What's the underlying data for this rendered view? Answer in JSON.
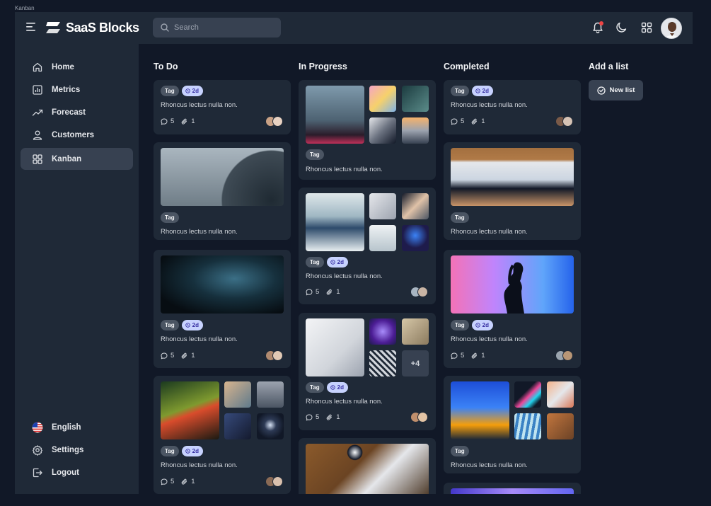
{
  "window": {
    "label": "Kanban"
  },
  "header": {
    "logo_text": "SaaS Blocks",
    "search_placeholder": "Search",
    "icons": [
      "menu-icon",
      "search-icon",
      "bell-icon",
      "moon-icon",
      "apps-grid-icon"
    ],
    "notification_color": "#ef4444"
  },
  "sidebar": {
    "items": [
      {
        "label": "Home",
        "icon": "home-icon",
        "active": false
      },
      {
        "label": "Metrics",
        "icon": "bar-chart-icon",
        "active": false
      },
      {
        "label": "Forecast",
        "icon": "trend-up-icon",
        "active": false
      },
      {
        "label": "Customers",
        "icon": "users-icon",
        "active": false
      },
      {
        "label": "Kanban",
        "icon": "grid-icon",
        "active": true
      }
    ],
    "bottom": [
      {
        "label": "English",
        "icon": "us-flag-icon"
      },
      {
        "label": "Settings",
        "icon": "gear-icon"
      },
      {
        "label": "Logout",
        "icon": "logout-icon"
      }
    ]
  },
  "board": {
    "columns": [
      {
        "title": "To Do"
      },
      {
        "title": "In Progress"
      },
      {
        "title": "Completed"
      },
      {
        "title": "Add a list"
      }
    ],
    "new_list_label": "New list",
    "card": {
      "tag": "Tag",
      "time": "2d",
      "text": "Rhoncus lectus nulla non.",
      "comments": "5",
      "attachments": "1",
      "more_images": "+4"
    }
  },
  "colors": {
    "background": "#111827",
    "panel": "#1f2937",
    "time_badge": "#c7d2fe",
    "tag_badge": "#4b5563"
  }
}
